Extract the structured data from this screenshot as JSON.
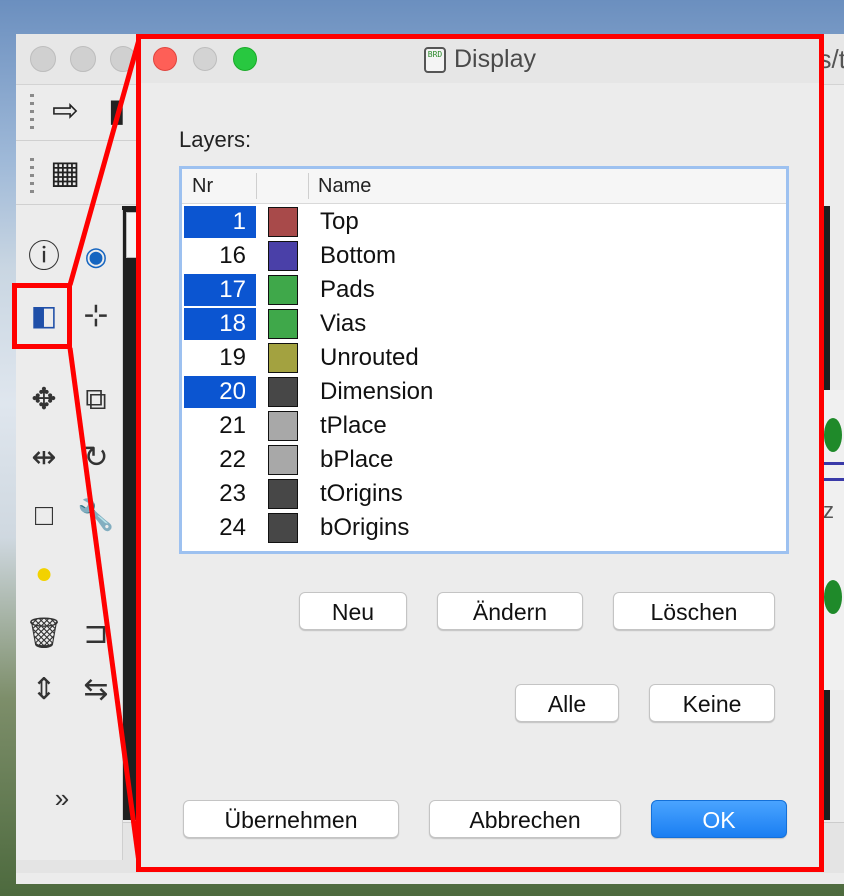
{
  "background_window": {
    "title_tail": "s/t"
  },
  "dialog": {
    "title": "Display",
    "title_icon_text": "BRD",
    "layers_label": "Layers:",
    "columns": {
      "nr": "Nr",
      "color": "",
      "name": "Name"
    },
    "layers": [
      {
        "nr": "1",
        "name": "Top",
        "color": "#a84a4a",
        "selected": true
      },
      {
        "nr": "16",
        "name": "Bottom",
        "color": "#4a40a8",
        "selected": false
      },
      {
        "nr": "17",
        "name": "Pads",
        "color": "#3fa84a",
        "selected": true
      },
      {
        "nr": "18",
        "name": "Vias",
        "color": "#3fa84a",
        "selected": true
      },
      {
        "nr": "19",
        "name": "Unrouted",
        "color": "#a3a240",
        "selected": false
      },
      {
        "nr": "20",
        "name": "Dimension",
        "color": "#474747",
        "selected": true
      },
      {
        "nr": "21",
        "name": "tPlace",
        "color": "#a8a8a8",
        "selected": false
      },
      {
        "nr": "22",
        "name": "bPlace",
        "color": "#a8a8a8",
        "selected": false
      },
      {
        "nr": "23",
        "name": "tOrigins",
        "color": "#474747",
        "selected": false
      },
      {
        "nr": "24",
        "name": "bOrigins",
        "color": "#474747",
        "selected": false
      }
    ],
    "buttons": {
      "neu": "Neu",
      "aendern": "Ändern",
      "loeschen": "Löschen",
      "alle": "Alle",
      "keine": "Keine",
      "uebernehmen": "Übernehmen",
      "abbrechen": "Abbrechen",
      "ok": "OK"
    }
  },
  "colors": {
    "highlight_red": "#ff0000",
    "selection_blue": "#0b55d1",
    "ok_blue": "#1a8cff"
  }
}
